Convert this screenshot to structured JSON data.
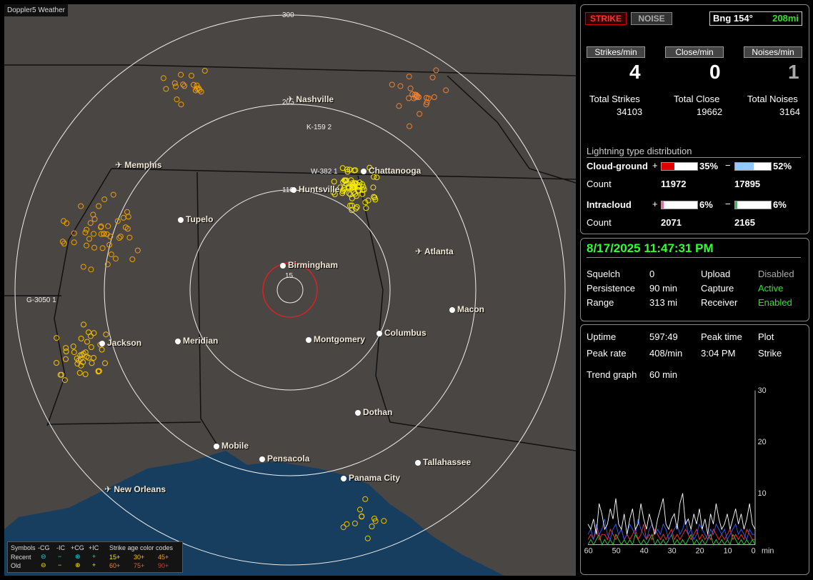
{
  "map": {
    "title": "Doppler5 Weather",
    "range_labels": [
      "300",
      "205",
      "110",
      "15"
    ],
    "strike_labels": [
      "K-159 2",
      "W-382 1",
      "G-3050 1"
    ],
    "cities": [
      {
        "name": "Nashville",
        "airport": true
      },
      {
        "name": "Memphis",
        "airport": true
      },
      {
        "name": "Chattanooga",
        "airport": false
      },
      {
        "name": "Huntsville",
        "airport": false
      },
      {
        "name": "Tupelo",
        "airport": false
      },
      {
        "name": "Atlanta",
        "airport": true
      },
      {
        "name": "Birmingham",
        "airport": false
      },
      {
        "name": "Macon",
        "airport": false
      },
      {
        "name": "Jackson",
        "airport": false
      },
      {
        "name": "Meridian",
        "airport": false
      },
      {
        "name": "Montgomery",
        "airport": false
      },
      {
        "name": "Columbus",
        "airport": false
      },
      {
        "name": "Dothan",
        "airport": false
      },
      {
        "name": "Mobile",
        "airport": false
      },
      {
        "name": "Pensacola",
        "airport": false
      },
      {
        "name": "Tallahassee",
        "airport": false
      },
      {
        "name": "Panama City",
        "airport": false
      },
      {
        "name": "New Orleans",
        "airport": true
      }
    ],
    "legend": {
      "symbols": "Symbols",
      "ncg": "-CG",
      "nic": "-IC",
      "pcg": "+CG",
      "pic": "+IC",
      "recent": "Recent",
      "old": "Old",
      "age_title": "Strike age color codes",
      "recent_ages": [
        "15+",
        "30+",
        "45+"
      ],
      "old_ages": [
        "60+",
        "75+",
        "90+"
      ]
    }
  },
  "status": {
    "strike_label": "STRIKE",
    "noise_label": "NOISE",
    "bearing": "Bng 154°",
    "distance": "208mi",
    "strikes_min_label": "Strikes/min",
    "close_min_label": "Close/min",
    "noises_min_label": "Noises/min",
    "strikes_min": "4",
    "close_min": "0",
    "noises_min": "1",
    "total_strikes_label": "Total Strikes",
    "total_close_label": "Total Close",
    "total_noises_label": "Total Noises",
    "total_strikes": "34103",
    "total_close": "19662",
    "total_noises": "3164",
    "dist_title": "Lightning type distribution",
    "cg_label": "Cloud-ground",
    "ic_label": "Intracloud",
    "count_label": "Count",
    "plus": "+",
    "minus": "−",
    "cg_pos_pct": "35%",
    "cg_neg_pct": "52%",
    "cg_pos_count": "11972",
    "cg_neg_count": "17895",
    "ic_pos_pct": "6%",
    "ic_neg_pct": "6%",
    "ic_pos_count": "2071",
    "ic_neg_count": "2165",
    "cg_pos_frac": 0.35,
    "cg_neg_frac": 0.52,
    "ic_pos_frac": 0.06,
    "ic_neg_frac": 0.06
  },
  "settings": {
    "datetime": "8/17/2025 11:47:31 PM",
    "squelch_label": "Squelch",
    "squelch": "0",
    "persistence_label": "Persistence",
    "persistence": "90 min",
    "range_label": "Range",
    "range": "313 mi",
    "upload_label": "Upload",
    "upload": "Disabled",
    "capture_label": "Capture",
    "capture": "Active",
    "receiver_label": "Receiver",
    "receiver": "Enabled"
  },
  "stats": {
    "uptime_label": "Uptime",
    "uptime": "597:49",
    "peak_time_label": "Peak time",
    "peak_time": "3:04 PM",
    "plot_label": "Plot",
    "plot": "Strike",
    "peak_rate_label": "Peak rate",
    "peak_rate": "408/min",
    "trend_label": "Trend graph",
    "trend": "60 min"
  },
  "chart_data": {
    "type": "line",
    "x_tick_labels": [
      "60",
      "50",
      "40",
      "30",
      "20",
      "10",
      "0"
    ],
    "x_unit": "min",
    "y_tick_labels": [
      "30",
      "20",
      "10"
    ],
    "xlim": [
      60,
      0
    ],
    "ylim": [
      0,
      30
    ],
    "series": [
      {
        "color": "#ffffff",
        "values": [
          4,
          3,
          5,
          2,
          8,
          6,
          3,
          4,
          7,
          5,
          9,
          4,
          3,
          6,
          2,
          5,
          7,
          3,
          4,
          8,
          5,
          3,
          6,
          4,
          2,
          5,
          7,
          9,
          4,
          3,
          5,
          6,
          3,
          8,
          10,
          4,
          5,
          3,
          6,
          4,
          7,
          3,
          5,
          2,
          6,
          4,
          8,
          5,
          3,
          4,
          6,
          3,
          5,
          7,
          4,
          6,
          3,
          5,
          8,
          4,
          3
        ]
      },
      {
        "color": "#3060ff",
        "values": [
          2,
          3,
          1,
          4,
          2,
          3,
          5,
          2,
          1,
          3,
          4,
          2,
          3,
          1,
          2,
          4,
          3,
          2,
          5,
          3,
          2,
          1,
          3,
          4,
          2,
          3,
          2,
          4,
          3,
          1,
          2,
          3,
          4,
          2,
          3,
          5,
          2,
          3,
          1,
          2,
          4,
          3,
          2,
          1,
          3,
          2,
          4,
          3,
          2,
          3,
          1,
          2,
          3,
          4,
          2,
          3,
          2,
          1,
          3,
          2,
          2
        ]
      },
      {
        "color": "#ff3030",
        "values": [
          1,
          2,
          1,
          3,
          1,
          2,
          2,
          1,
          3,
          2,
          1,
          2,
          3,
          1,
          2,
          1,
          2,
          3,
          1,
          2,
          4,
          1,
          2,
          1,
          3,
          2,
          1,
          2,
          1,
          2,
          3,
          1,
          2,
          1,
          2,
          3,
          2,
          1,
          2,
          3,
          1,
          2,
          1,
          2,
          1,
          3,
          2,
          1,
          2,
          1,
          2,
          3,
          1,
          2,
          1,
          2,
          1,
          3,
          2,
          1,
          1
        ]
      },
      {
        "color": "#30d040",
        "values": [
          0,
          1,
          0,
          1,
          2,
          0,
          1,
          0,
          1,
          0,
          2,
          1,
          0,
          1,
          0,
          1,
          0,
          2,
          1,
          0,
          1,
          0,
          1,
          2,
          0,
          1,
          0,
          1,
          0,
          1,
          2,
          0,
          1,
          0,
          1,
          0,
          1,
          2,
          0,
          1,
          0,
          1,
          0,
          1,
          2,
          0,
          1,
          0,
          1,
          0,
          1,
          0,
          2,
          1,
          0,
          1,
          0,
          1,
          0,
          1,
          0
        ]
      }
    ]
  }
}
